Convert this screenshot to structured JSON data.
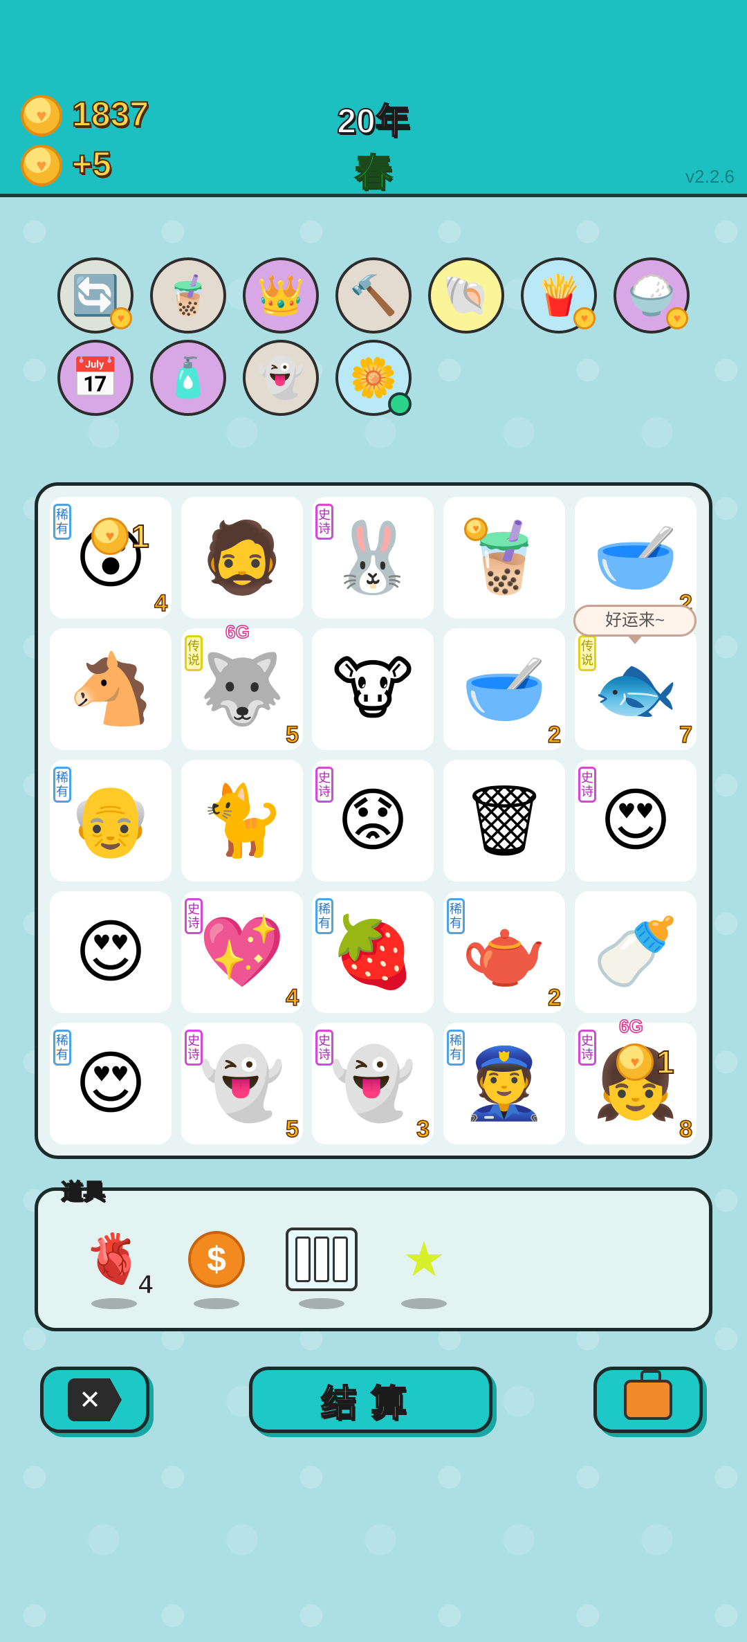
{
  "header": {
    "money": "1837",
    "income": "+5",
    "year": "20年",
    "season": "春",
    "version": "v2.2.6"
  },
  "round_items": [
    {
      "name": "refresh-icon",
      "glyph": "🔄",
      "bg": "#dde3d9",
      "mini": true
    },
    {
      "name": "bubble-tea-icon",
      "glyph": "🧋",
      "bg": "#e3dbcf",
      "mini": false
    },
    {
      "name": "magenta-box-icon",
      "glyph": "👑",
      "bg": "#d7a7e6",
      "mini": false
    },
    {
      "name": "hammer-icon",
      "glyph": "🔨",
      "bg": "#e3dbcf",
      "mini": false
    },
    {
      "name": "shell-icon",
      "glyph": "🐚",
      "bg": "#fbf59a",
      "mini": false
    },
    {
      "name": "fries-icon",
      "glyph": "🍟",
      "bg": "#b9e8f6",
      "mini": true
    },
    {
      "name": "rice-bowl-icon",
      "glyph": "🍚",
      "bg": "#d7a7e6",
      "mini": true
    },
    {
      "name": "calendar-icon",
      "glyph": "📅",
      "bg": "#d7a7e6",
      "mini": false
    },
    {
      "name": "spray-bottle-icon",
      "glyph": "🧴",
      "bg": "#d7a7e6",
      "mini": false
    },
    {
      "name": "ghost-wink-icon",
      "glyph": "👻",
      "bg": "#e3dbcf",
      "mini": false
    },
    {
      "name": "flower-pot-icon",
      "glyph": "🌼",
      "bg": "#b9e8f6",
      "mini": false,
      "dot": true
    }
  ],
  "tiles": [
    {
      "name": "old-man-shocked-tile",
      "glyph": "😮",
      "badge": "稀有",
      "badge_type": "rare",
      "count": "4",
      "plus": "1"
    },
    {
      "name": "bearded-worker-tile",
      "glyph": "🧔",
      "badge": "",
      "badge_type": "",
      "count": ""
    },
    {
      "name": "rabbit-temple-tile",
      "glyph": "🐰",
      "badge": "史诗",
      "badge_type": "epic",
      "count": ""
    },
    {
      "name": "milk-tea-tile",
      "glyph": "🧋",
      "badge": "",
      "badge_type": "",
      "count": "",
      "small_coin": true
    },
    {
      "name": "bowl-tile",
      "glyph": "🥣",
      "badge": "",
      "badge_type": "",
      "count": "2"
    },
    {
      "name": "horse-tile",
      "glyph": "🐴",
      "badge": "",
      "badge_type": "",
      "count": ""
    },
    {
      "name": "husky-king-tile",
      "glyph": "🐺",
      "badge": "传说",
      "badge_type": "legend",
      "count": "5",
      "g6": "6G"
    },
    {
      "name": "cow-tile",
      "glyph": "🐮",
      "badge": "",
      "badge_type": "",
      "count": ""
    },
    {
      "name": "bowl-tile-2",
      "glyph": "🥣",
      "badge": "",
      "badge_type": "",
      "count": "2"
    },
    {
      "name": "koi-fish-tile",
      "glyph": "🐟",
      "badge": "传说",
      "badge_type": "legend",
      "count": "7"
    },
    {
      "name": "bald-man-tile",
      "glyph": "👴",
      "badge": "稀有",
      "badge_type": "rare",
      "count": ""
    },
    {
      "name": "cat-tile",
      "glyph": "🐈",
      "badge": "",
      "badge_type": "",
      "count": ""
    },
    {
      "name": "grumpy-old-man-tile",
      "glyph": "😟",
      "badge": "史诗",
      "badge_type": "epic",
      "count": ""
    },
    {
      "name": "trash-bag-tile",
      "glyph": "🗑",
      "badge": "",
      "badge_type": "",
      "count": ""
    },
    {
      "name": "love-old-man-tile",
      "glyph": "😍",
      "badge": "史诗",
      "badge_type": "epic",
      "count": ""
    },
    {
      "name": "love-grandpa-tile",
      "glyph": "😍",
      "badge": "",
      "badge_type": "",
      "count": ""
    },
    {
      "name": "heart-ghost-tile",
      "glyph": "💖",
      "badge": "史诗",
      "badge_type": "epic",
      "count": "4"
    },
    {
      "name": "lychee-tile",
      "glyph": "🍓",
      "badge": "稀有",
      "badge_type": "rare",
      "count": ""
    },
    {
      "name": "teapot-tile",
      "glyph": "🫖",
      "badge": "稀有",
      "badge_type": "rare",
      "count": "2"
    },
    {
      "name": "milk-bottle-tile",
      "glyph": "🍼",
      "badge": "",
      "badge_type": "",
      "count": ""
    },
    {
      "name": "love-bald-man-tile",
      "glyph": "😍",
      "badge": "稀有",
      "badge_type": "rare",
      "count": ""
    },
    {
      "name": "dead-ghost-tile",
      "glyph": "👻",
      "badge": "史诗",
      "badge_type": "epic",
      "count": "5"
    },
    {
      "name": "love-ghost-tile",
      "glyph": "👻",
      "badge": "史诗",
      "badge_type": "epic",
      "count": "3"
    },
    {
      "name": "police-tile",
      "glyph": "👮",
      "badge": "稀有",
      "badge_type": "rare",
      "count": ""
    },
    {
      "name": "girl-tile",
      "glyph": "👧",
      "badge": "史诗",
      "badge_type": "epic",
      "count": "8",
      "plus": "1",
      "g6": "6G"
    }
  ],
  "speech": "好运来~",
  "tools": {
    "label": "道具",
    "liver_count": "4"
  },
  "buttons": {
    "settle": "结算"
  }
}
